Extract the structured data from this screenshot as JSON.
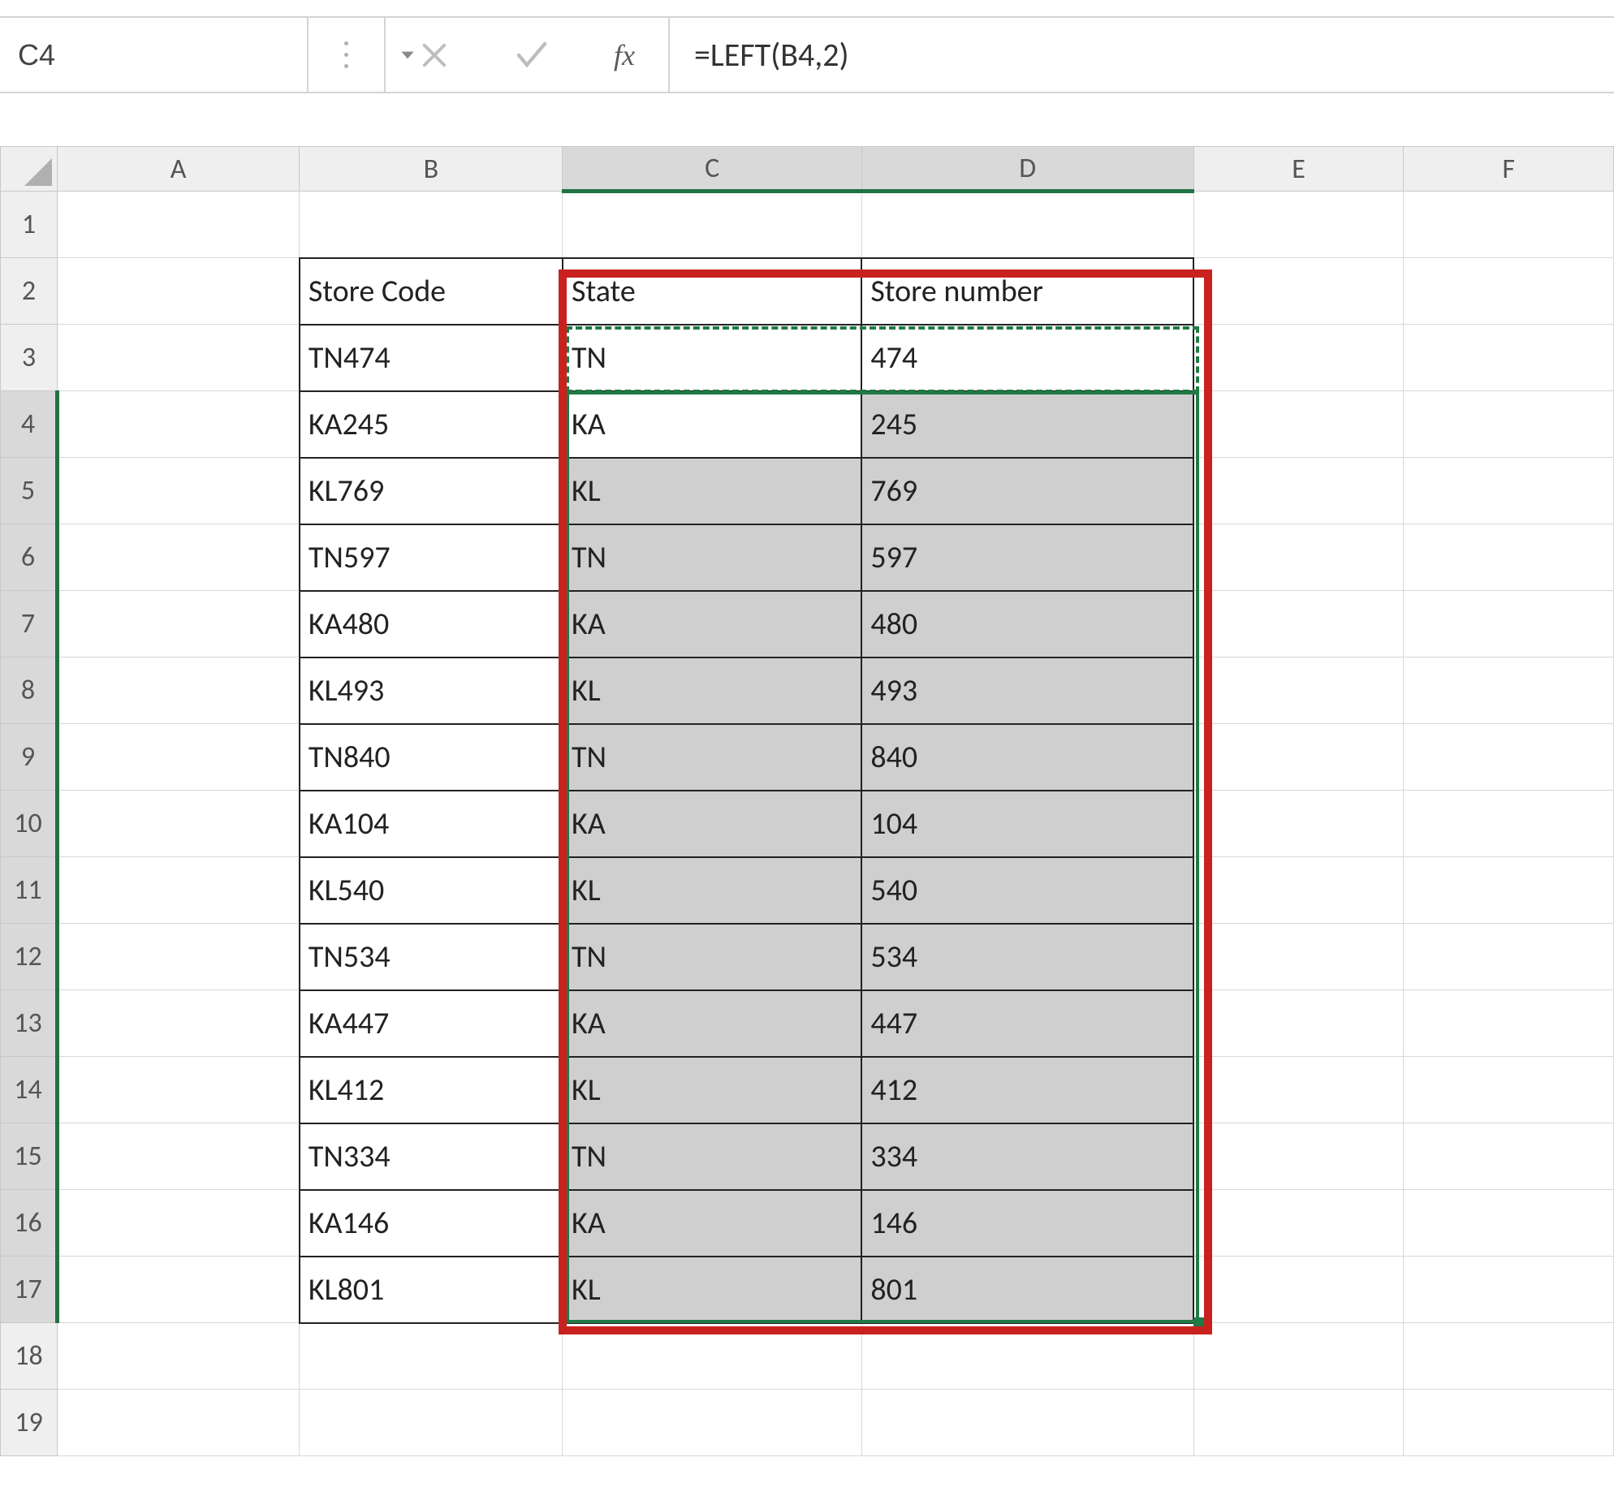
{
  "formula_bar": {
    "cell_ref": "C4",
    "fx_label": "fx",
    "formula": "=LEFT(B4,2)"
  },
  "columns": [
    "A",
    "B",
    "C",
    "D",
    "E",
    "F"
  ],
  "row_count": 19,
  "visible_row_numbers": [
    "1",
    "2",
    "3",
    "4",
    "5",
    "6",
    "7",
    "8",
    "9",
    "10",
    "11",
    "12",
    "13",
    "14",
    "15",
    "16",
    "17",
    "18",
    "19"
  ],
  "table": {
    "headers": {
      "b": "Store Code",
      "c": "State",
      "d": "Store number"
    },
    "rows": [
      {
        "b": "TN474",
        "c": "TN",
        "d": "474"
      },
      {
        "b": "KA245",
        "c": "KA",
        "d": "245"
      },
      {
        "b": "KL769",
        "c": "KL",
        "d": "769"
      },
      {
        "b": "TN597",
        "c": "TN",
        "d": "597"
      },
      {
        "b": "KA480",
        "c": "KA",
        "d": "480"
      },
      {
        "b": "KL493",
        "c": "KL",
        "d": "493"
      },
      {
        "b": "TN840",
        "c": "TN",
        "d": "840"
      },
      {
        "b": "KA104",
        "c": "KA",
        "d": "104"
      },
      {
        "b": "KL540",
        "c": "KL",
        "d": "540"
      },
      {
        "b": "TN534",
        "c": "TN",
        "d": "534"
      },
      {
        "b": "KA447",
        "c": "KA",
        "d": "447"
      },
      {
        "b": "KL412",
        "c": "KL",
        "d": "412"
      },
      {
        "b": "TN334",
        "c": "TN",
        "d": "334"
      },
      {
        "b": "KA146",
        "c": "KA",
        "d": "146"
      },
      {
        "b": "KL801",
        "c": "KL",
        "d": "801"
      }
    ]
  },
  "selection": {
    "active_cell": "C4",
    "range": "C4:D17",
    "copy_range": "C3:D3"
  },
  "colors": {
    "excel_green": "#217346",
    "callout_red": "#c9211e"
  }
}
